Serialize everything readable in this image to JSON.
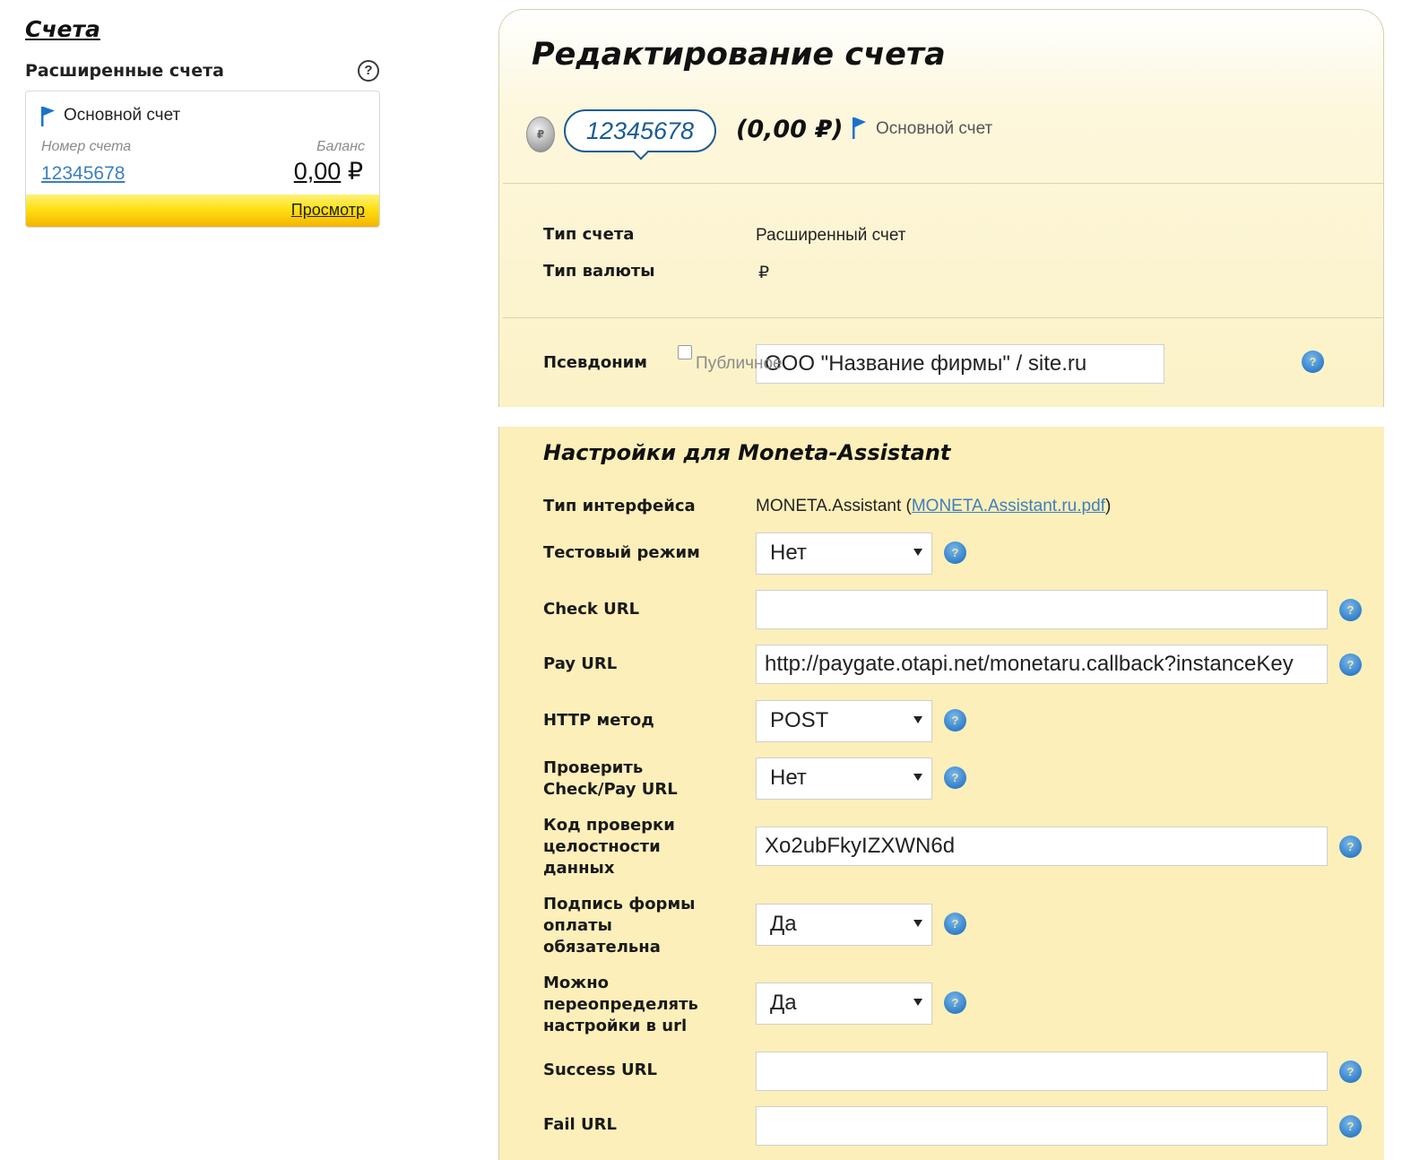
{
  "sidebar": {
    "title": "Счета",
    "subtitle": "Расширенные счета",
    "help": "?",
    "card": {
      "name": "Основной счет",
      "number_label": "Номер счета",
      "balance_label": "Баланс",
      "number": "12345678",
      "balance": "0,00",
      "currency": "₽",
      "view_link": "Просмотр"
    }
  },
  "panel": {
    "title": "Редактирование счета",
    "account_number": "12345678",
    "balance": "(0,00 ₽)",
    "account_name": "Основной счет",
    "account_type_label": "Тип счета",
    "account_type_value": "Расширенный счет",
    "currency_label": "Тип валюты",
    "currency_value": "₽",
    "alias_label": "Псевдоним",
    "alias_value": "ООО \"Название фирмы\" / site.ru",
    "public_label": "Публичное"
  },
  "settings": {
    "title": "Настройки для Moneta-Assistant",
    "interface_label": "Тип интерфейса",
    "interface_value": "MONETA.Assistant (",
    "interface_link": "MONETA.Assistant.ru.pdf",
    "interface_close": ")",
    "test_mode_label": "Тестовый режим",
    "test_mode_value": "Нет",
    "check_url_label": "Check URL",
    "check_url_value": "",
    "pay_url_label": "Pay URL",
    "pay_url_value": "http://paygate.otapi.net/monetaru.callback?instanceKey",
    "http_method_label": "HTTP метод",
    "http_method_value": "POST",
    "verify_label_1": "Проверить",
    "verify_label_2": "Check/Pay URL",
    "verify_value": "Нет",
    "integrity_label_1": "Код проверки",
    "integrity_label_2": "целостности",
    "integrity_label_3": "данных",
    "integrity_value": "Xo2ubFkyIZXWN6d",
    "signature_label_1": "Подпись формы",
    "signature_label_2": "оплаты",
    "signature_label_3": "обязательна",
    "signature_value": "Да",
    "override_label_1": "Можно",
    "override_label_2": "переопределять",
    "override_label_3": "настройки в url",
    "override_value": "Да",
    "success_url_label": "Success URL",
    "success_url_value": "",
    "fail_url_label": "Fail URL",
    "fail_url_value": ""
  },
  "icons": {
    "help": "question-mark",
    "flag": "blue-flag",
    "coin": "ruble-coin",
    "select": "caret-down"
  },
  "colors": {
    "accent_blue": "#1b5b93",
    "link_blue": "#3d7ec1",
    "panel_yellow": "#fcefb9",
    "card_footer_yellow": "#ffe013"
  }
}
